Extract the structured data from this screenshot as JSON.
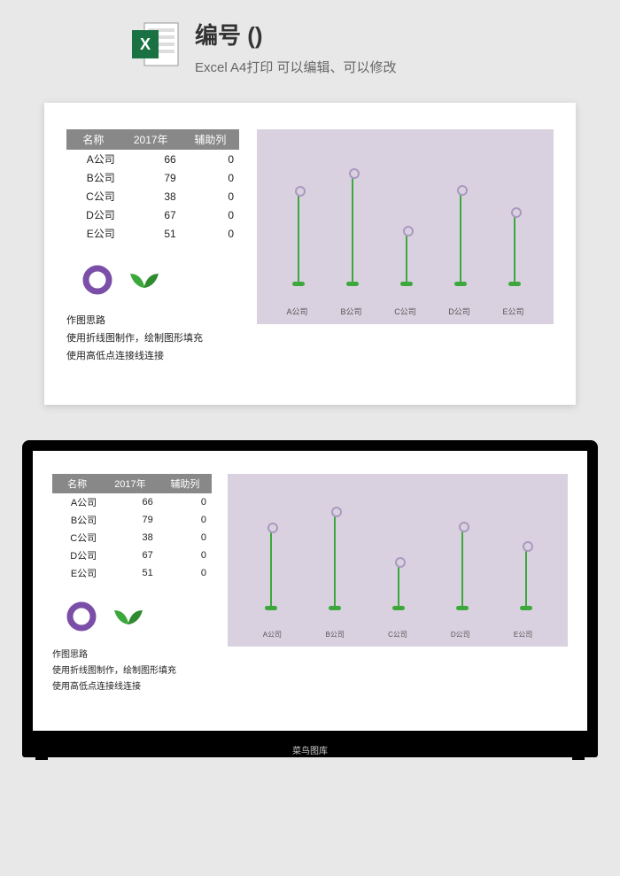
{
  "header": {
    "title": "编号 ()",
    "subtitle": "Excel A4打印 可以编辑、可以修改"
  },
  "table": {
    "headers": [
      "名称",
      "2017年",
      "辅助列"
    ],
    "rows": [
      [
        "A公司",
        "66",
        "0"
      ],
      [
        "B公司",
        "79",
        "0"
      ],
      [
        "C公司",
        "38",
        "0"
      ],
      [
        "D公司",
        "67",
        "0"
      ],
      [
        "E公司",
        "51",
        "0"
      ]
    ]
  },
  "notes": {
    "line1": "作图思路",
    "line2": "使用折线图制作，绘制图形填充",
    "line3": "使用高低点连接线连接"
  },
  "laptop": {
    "watermark": "菜鸟图库"
  },
  "chart_data": {
    "type": "bar",
    "categories": [
      "A公司",
      "B公司",
      "C公司",
      "D公司",
      "E公司"
    ],
    "values": [
      66,
      79,
      38,
      67,
      51
    ],
    "title": "",
    "xlabel": "",
    "ylabel": "",
    "ylim": [
      0,
      100
    ]
  }
}
